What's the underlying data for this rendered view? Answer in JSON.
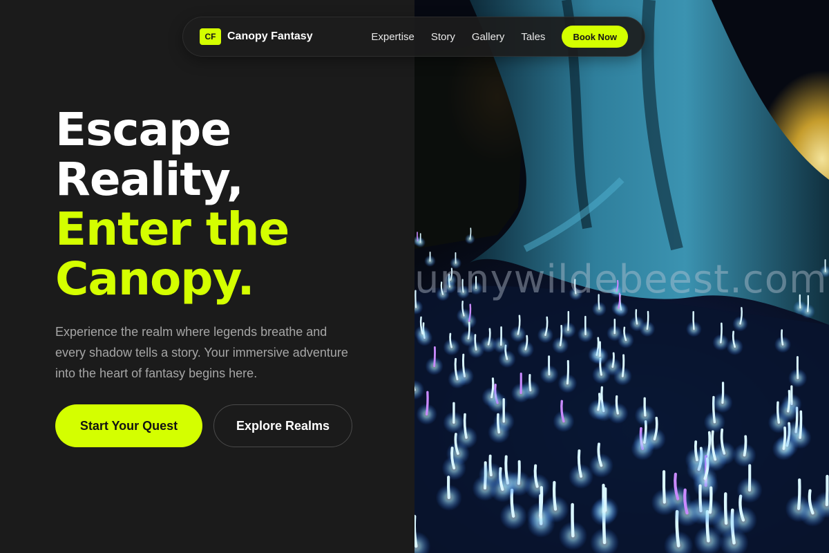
{
  "nav": {
    "logo_mark": "CF",
    "brand": "Canopy Fantasy",
    "links": [
      "Expertise",
      "Story",
      "Gallery",
      "Tales"
    ],
    "cta": "Book Now"
  },
  "hero": {
    "headline_line1": "Escape",
    "headline_line2": "Reality,",
    "headline_line3": "Enter the",
    "headline_line4": "Canopy.",
    "subtext": "Experience the realm where legends breathe and every shadow tells a story. Your immersive adventure into the heart of fantasy begins here.",
    "primary_cta": "Start Your Quest",
    "secondary_cta": "Explore Realms"
  },
  "image": {
    "subject": "glowing blue mushrooms at the base of a giant illuminated tree at night",
    "watermark": "unnywildebeest.com"
  },
  "colors": {
    "background": "#1b1b1b",
    "accent": "#d4ff00",
    "text_primary": "#ffffff",
    "text_muted": "#a6a6a6",
    "glow": "#7fd8ff"
  }
}
